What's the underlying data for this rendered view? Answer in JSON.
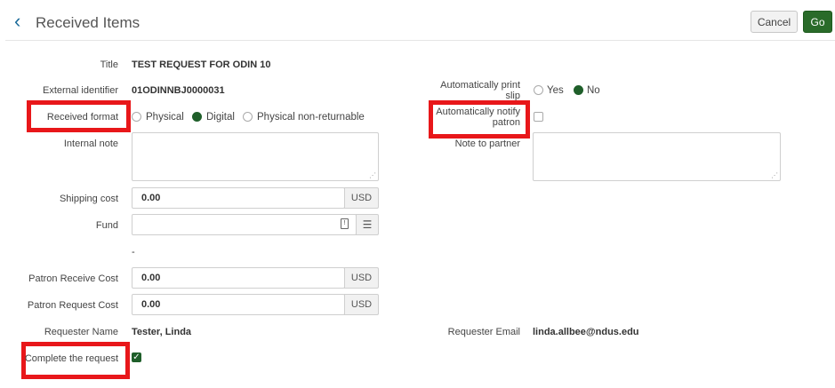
{
  "header": {
    "back_glyph": "‹",
    "title": "Received Items",
    "cancel_label": "Cancel",
    "go_label": "Go"
  },
  "form": {
    "title": {
      "label": "Title",
      "value": "TEST REQUEST FOR ODIN 10"
    },
    "external_identifier": {
      "label": "External identifier",
      "value": "01ODINNBJ0000031"
    },
    "received_format": {
      "label": "Received format",
      "options": [
        "Physical",
        "Digital",
        "Physical non-returnable"
      ],
      "selected": "Digital"
    },
    "internal_note": {
      "label": "Internal note",
      "value": ""
    },
    "shipping_cost": {
      "label": "Shipping cost",
      "value": "0.00",
      "currency": "USD"
    },
    "fund": {
      "label": "Fund",
      "value": "",
      "below_value": "-"
    },
    "patron_receive_cost": {
      "label": "Patron Receive Cost",
      "value": "0.00",
      "currency": "USD"
    },
    "patron_request_cost": {
      "label": "Patron Request Cost",
      "value": "0.00",
      "currency": "USD"
    },
    "requester_name": {
      "label": "Requester Name",
      "value": "Tester, Linda"
    },
    "complete_request": {
      "label": "Complete the request",
      "checked": true
    },
    "auto_print_slip": {
      "label_line1": "Automatically print",
      "label_line2": "slip",
      "options": [
        "Yes",
        "No"
      ],
      "selected": "No"
    },
    "auto_notify_patron": {
      "label_line1": "Automatically notify",
      "label_line2": "patron",
      "checked": false
    },
    "note_to_partner": {
      "label": "Note to partner",
      "value": ""
    },
    "requester_email": {
      "label": "Requester Email",
      "value": "linda.allbee@ndus.edu"
    }
  },
  "colors": {
    "accent_green": "#1f5f2a",
    "highlight_red": "#e8171a",
    "link_blue": "#1b6b9a"
  }
}
